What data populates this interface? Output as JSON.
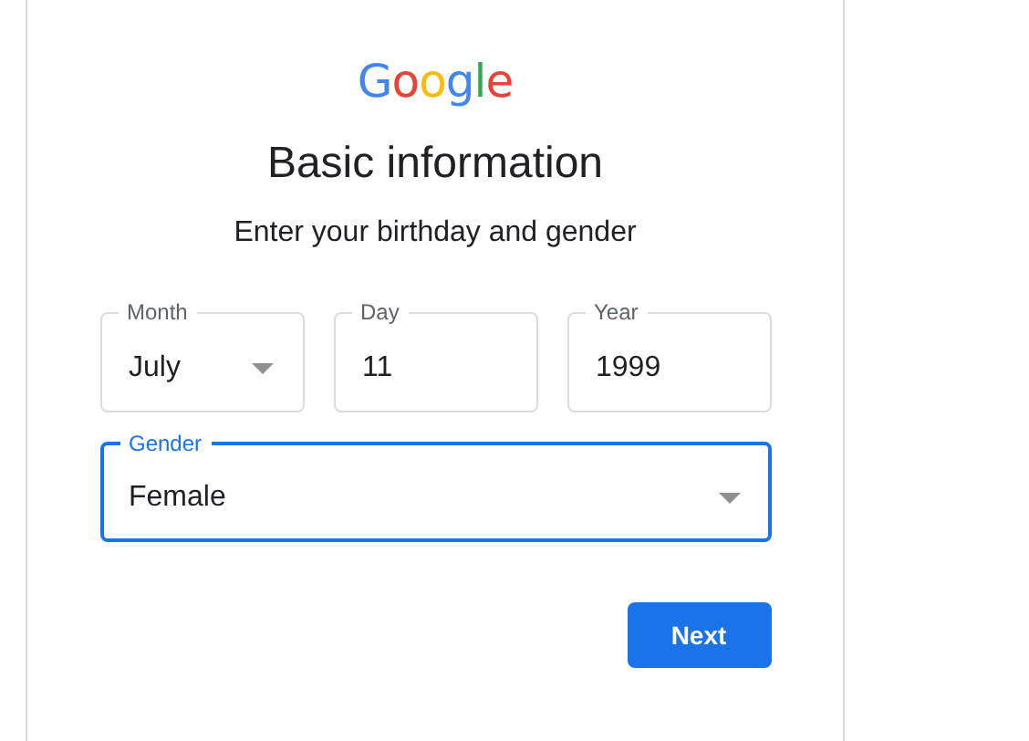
{
  "logo": "Google",
  "title": "Basic information",
  "subtitle": "Enter your birthday and gender",
  "field_rows": [
    [
      {
        "label": "Month",
        "value": "July",
        "kind": "select",
        "focused": false
      },
      {
        "label": "Day",
        "value": "11",
        "kind": "text",
        "focused": false
      },
      {
        "label": "Year",
        "value": "1999",
        "kind": "text",
        "focused": false
      }
    ],
    [
      {
        "label": "Gender",
        "value": "Female",
        "kind": "select",
        "focused": true
      }
    ]
  ],
  "next_button": "Next"
}
